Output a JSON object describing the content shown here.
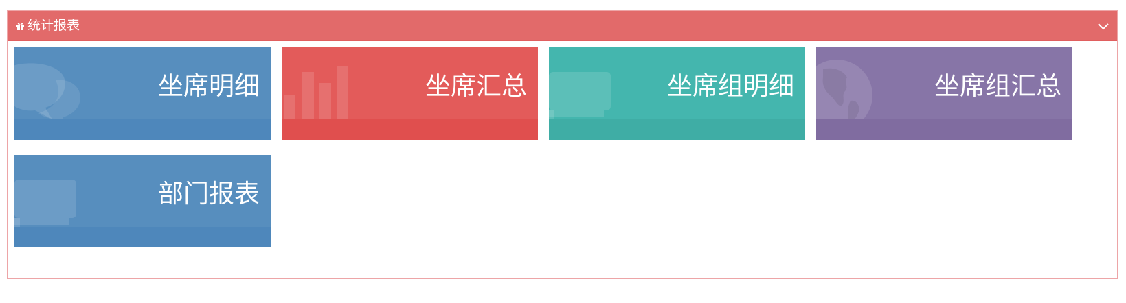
{
  "panel": {
    "title": "统计报表",
    "header_color": "#e26a6a",
    "border_color": "#eda5a7"
  },
  "tiles": [
    {
      "label": "坐席明细",
      "icon": "comments-icon",
      "color": "#578ebe",
      "footer_color": "#4e87bb"
    },
    {
      "label": "坐席汇总",
      "icon": "bar-chart-icon",
      "color": "#e35b5a",
      "footer_color": "#e04f4e"
    },
    {
      "label": "坐席组明细",
      "icon": "shopping-cart-icon",
      "color": "#44b6ae",
      "footer_color": "#3fada5"
    },
    {
      "label": "坐席组汇总",
      "icon": "globe-icon",
      "color": "#8775a7",
      "footer_color": "#806ca0"
    },
    {
      "label": "部门报表",
      "icon": "shopping-cart-icon",
      "color": "#578ebe",
      "footer_color": "#4e87bb"
    }
  ]
}
